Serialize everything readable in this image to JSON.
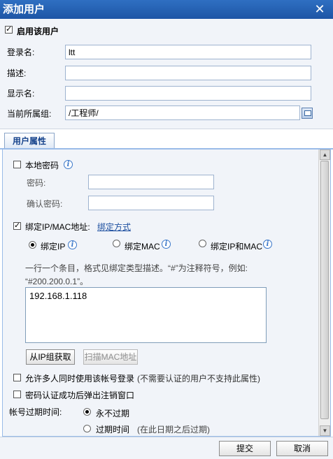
{
  "window": {
    "title": "添加用户",
    "close_glyph": "✕"
  },
  "enable_user": {
    "label": "启用该用户",
    "checked": true
  },
  "form": {
    "login_label": "登录名:",
    "login_value": "ltt",
    "desc_label": "描述:",
    "desc_value": "",
    "display_label": "显示名:",
    "display_value": "",
    "group_label": "当前所属组:",
    "group_value": "/工程师/"
  },
  "tab": {
    "label": "用户属性"
  },
  "local_password": {
    "label": "本地密码",
    "checked": false,
    "password_label": "密码:",
    "confirm_label": "确认密码:"
  },
  "bind": {
    "label": "绑定IP/MAC地址:",
    "checked": true,
    "method_link": "绑定方式",
    "options": [
      "绑定IP",
      "绑定MAC",
      "绑定IP和MAC"
    ],
    "selected": 0,
    "hint_line1": "一行一个条目，格式见绑定类型描述。“#”为注释符号，例如:",
    "hint_line2": "“#200.200.0.1”。",
    "entries": "192.168.1.118",
    "from_group_button": "从IP组获取",
    "scan_mac_button": "扫描MAC地址"
  },
  "multi_login": {
    "label": "允许多人同时使用该帐号登录",
    "note": "(不需要认证的用户不支持此属性)",
    "checked": false
  },
  "popup_logout": {
    "label": "密码认证成功后弹出注销窗口",
    "checked": false
  },
  "expiry": {
    "label": "帐号过期时间:",
    "never": "永不过期",
    "expire_at": "过期时间",
    "expire_note": "(在此日期之后过期)",
    "selected": 0
  },
  "footer": {
    "submit": "提交",
    "cancel": "取消"
  },
  "icons": {
    "info": "info-icon",
    "group": "group-select-icon",
    "close": "close-icon"
  },
  "colors": {
    "title_bar": "#2f6fc2",
    "link": "#1d4fa0",
    "tab_border": "#99bbe8"
  }
}
